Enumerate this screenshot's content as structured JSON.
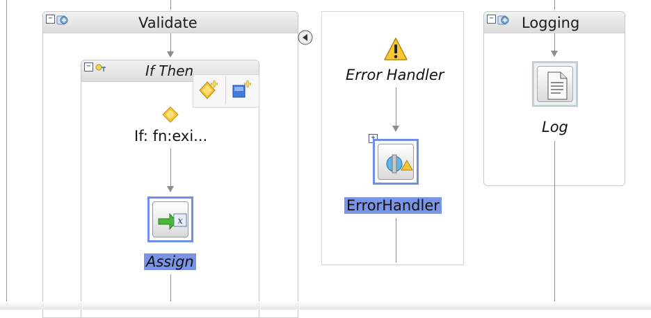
{
  "scopes": {
    "validate": {
      "title": "Validate"
    },
    "if_then": {
      "title": "If Then"
    },
    "logging": {
      "title": "Logging"
    }
  },
  "nodes": {
    "if_condition": {
      "label": "If: fn:exi..."
    },
    "assign": {
      "label": "Assign"
    },
    "error_handler_title": {
      "label": "Error Handler"
    },
    "error_handler_activity": {
      "label": "ErrorHandler"
    },
    "log": {
      "label": "Log"
    }
  },
  "colors": {
    "selection": "#7b95e6",
    "connector": "#8c8c8c",
    "header": "#dcdcdc"
  },
  "icons": {
    "collapse": "−",
    "expand": "+"
  }
}
